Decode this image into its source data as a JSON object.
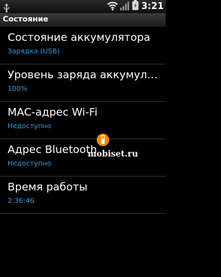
{
  "status_bar": {
    "time": "3:21",
    "icons": [
      "usb-icon",
      "wifi-icon",
      "signal-icon",
      "battery-icon"
    ]
  },
  "header": {
    "title": "Состояние"
  },
  "items": [
    {
      "title": "Состояние аккумулятора",
      "subtitle": "Зарядка (USB)"
    },
    {
      "title": "Уровень заряда аккумулятора",
      "subtitle": "100%"
    },
    {
      "title": "MAC-адрес Wi-Fi",
      "subtitle": "Недоступно"
    },
    {
      "title": "Адрес Bluetooth",
      "subtitle": "Недоступно"
    },
    {
      "title": "Время работы",
      "subtitle": "2:36:46"
    }
  ],
  "watermark": {
    "text": "mobiset.ru"
  },
  "colors": {
    "subtitle": "#2f9bdc",
    "background": "#000000",
    "divider": "#2e2e2e"
  }
}
